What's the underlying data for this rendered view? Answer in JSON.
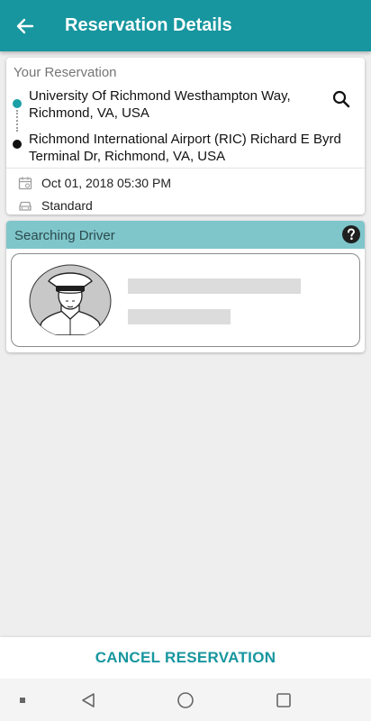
{
  "appbar": {
    "title": "Reservation Details",
    "back_icon": "arrow-left-icon",
    "color": "#17969f"
  },
  "reservation": {
    "header": "Your Reservation",
    "pickup": {
      "line1": "University Of Richmond Westhampton Way,",
      "line2": "Richmond, VA, USA",
      "marker_color": "#1aa0a6"
    },
    "dropoff": {
      "line1": "Richmond International Airport (RIC) Richard E Byrd",
      "line2": "Terminal Dr, Richmond, VA, USA",
      "marker_color": "#111111"
    },
    "search_icon": "search-icon",
    "datetime": "Oct 01, 2018 05:30 PM",
    "datetime_icon": "calendar-icon",
    "vehicle_type": "Standard",
    "vehicle_icon": "car-icon"
  },
  "driver": {
    "header": "Searching Driver",
    "help_icon": "help-icon",
    "avatar_icon": "chauffeur-avatar-icon",
    "header_color": "#7fc6cb"
  },
  "actions": {
    "cancel_label": "CANCEL RESERVATION"
  },
  "system_nav": {
    "items": [
      "menu-dot-icon",
      "back-triangle-icon",
      "home-circle-icon",
      "recents-square-icon"
    ]
  }
}
